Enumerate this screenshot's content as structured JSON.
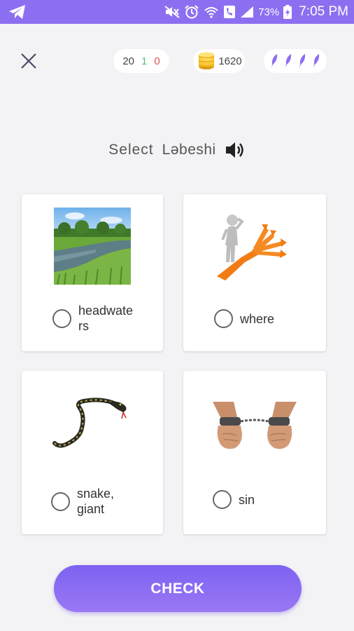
{
  "status_bar": {
    "battery": "73%",
    "time": "7:05 PM",
    "icons": [
      "telegram-icon",
      "mute-icon",
      "alarm-icon",
      "wifi-icon",
      "phone-icon",
      "signal-icon",
      "battery-icon"
    ]
  },
  "header": {
    "close_icon": "close-icon",
    "stats": {
      "total": "20",
      "correct": "1",
      "wrong": "0"
    },
    "coins": "1620",
    "lives_icon": "feather-icon",
    "lives_count": 4
  },
  "question": {
    "prompt": "Select",
    "word": "Ləbeshi",
    "audio_icon": "speaker-icon"
  },
  "options": [
    {
      "label_line1": "headwate",
      "label_line2": "rs",
      "image": "river-landscape-image"
    },
    {
      "label_line1": "where",
      "label_line2": "",
      "image": "person-choosing-direction-image"
    },
    {
      "label_line1": "snake,",
      "label_line2": "giant",
      "image": "snake-image"
    },
    {
      "label_line1": "sin",
      "label_line2": "",
      "image": "handcuffed-hands-image"
    }
  ],
  "check_button": {
    "label": "CHECK"
  },
  "colors": {
    "accent": "#8c6ff0",
    "correct": "#5bbf7a",
    "wrong": "#e2544f",
    "coin": "#f2b51d"
  }
}
